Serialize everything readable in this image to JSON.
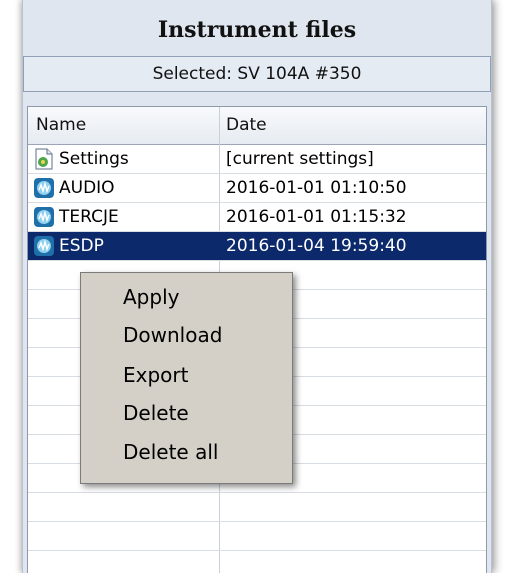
{
  "title": "Instrument files",
  "selected": "Selected: SV 104A #350",
  "columns": {
    "name": "Name",
    "date": "Date"
  },
  "files": [
    {
      "name": "Settings",
      "date": "[current settings]",
      "icon": "settings-file-icon"
    },
    {
      "name": "AUDIO",
      "date": "2016-01-01 01:10:50",
      "icon": "instrument-file-icon"
    },
    {
      "name": "TERCJE",
      "date": "2016-01-01 01:15:32",
      "icon": "instrument-file-icon"
    },
    {
      "name": "ESDP",
      "date": "2016-01-04 19:59:40",
      "icon": "instrument-file-icon",
      "selected": true
    }
  ],
  "context_menu": {
    "items": [
      "Apply",
      "Download",
      "Export",
      "Delete",
      "Delete all"
    ]
  },
  "colors": {
    "selection": "#0c2a6b",
    "menu_bg": "#d4d0c8",
    "panel_bg": "#dfe6ef"
  }
}
